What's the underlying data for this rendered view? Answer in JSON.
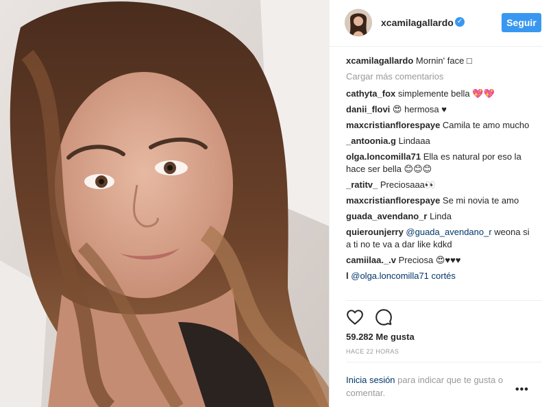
{
  "header": {
    "username": "xcamilagallardo",
    "verified_icon": "verified-badge-icon",
    "follow_label": "Seguir",
    "accent": "#3897f0"
  },
  "caption": {
    "user": "xcamilagallardo",
    "text": "Mornin' face □"
  },
  "load_more": "Cargar más comentarios",
  "comments": [
    {
      "user": "cathyta_fox",
      "text": "simplemente bella 💖💖"
    },
    {
      "user": "danii_flovi",
      "text": "😍 hermosa ♥"
    },
    {
      "user": "maxcristianflorespaye",
      "text": "Camila te amo mucho"
    },
    {
      "user": "_antoonia.g",
      "text": "Lindaaa"
    },
    {
      "user": "olga.loncomilla71",
      "text": "Ella es natural por eso la hace ser bella 😊😊😊"
    },
    {
      "user": "_ratitv_",
      "text": "Preciosaaa👀"
    },
    {
      "user": "maxcristianflorespaye",
      "text": "Se mi novia te amo"
    },
    {
      "user": "guada_avendano_r",
      "text": "Linda"
    },
    {
      "user": "quierounjerry",
      "mention": "@guada_avendano_r",
      "text": "weona si a ti no te va a dar like kdkd"
    },
    {
      "user": "camiilaa._.v",
      "text": "Preciosa 😍♥♥♥"
    },
    {
      "user": "l",
      "text": "@olga.loncomilla71 cortés"
    }
  ],
  "actions": {
    "like_icon": "heart-icon",
    "comment_icon": "comment-bubble-icon"
  },
  "likes": "59.282 Me gusta",
  "timestamp": "HACE 22 HORAS",
  "login": {
    "link": "Inicia sesión",
    "text": " para indicar que te gusta o comentar."
  },
  "more_icon": "more-options-icon",
  "more_glyph": "•••"
}
